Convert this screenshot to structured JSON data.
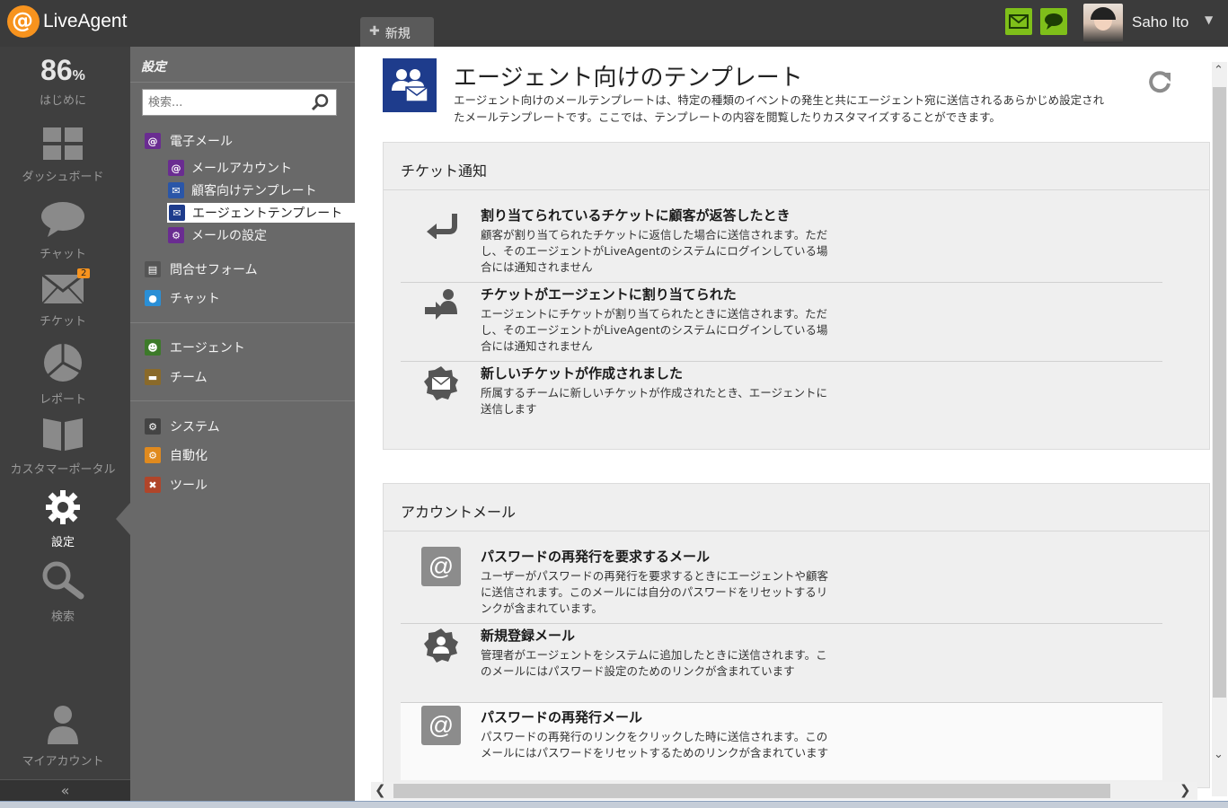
{
  "app": {
    "name": "LiveAgent",
    "new_tab": "新規"
  },
  "user": {
    "name": "Saho Ito"
  },
  "leftnav": {
    "progress_value": "86",
    "progress_unit": "%",
    "items": [
      {
        "label": "はじめに"
      },
      {
        "label": "ダッシュボード"
      },
      {
        "label": "チャット"
      },
      {
        "label": "チケット",
        "badge": "2"
      },
      {
        "label": "レポート"
      },
      {
        "label": "カスタマーポータル"
      },
      {
        "label": "設定"
      },
      {
        "label": "検索"
      },
      {
        "label": "マイアカウント"
      }
    ],
    "collapse": "«"
  },
  "settings": {
    "title": "設定",
    "search_placeholder": "検索...",
    "menu": [
      {
        "label": "電子メール"
      },
      {
        "label": "メールアカウント"
      },
      {
        "label": "顧客向けテンプレート"
      },
      {
        "label": "エージェントテンプレート"
      },
      {
        "label": "メールの設定"
      },
      {
        "label": "問合せフォーム"
      },
      {
        "label": "チャット"
      },
      {
        "label": "エージェント"
      },
      {
        "label": "チーム"
      },
      {
        "label": "システム"
      },
      {
        "label": "自動化"
      },
      {
        "label": "ツール"
      }
    ]
  },
  "page": {
    "title": "エージェント向けのテンプレート",
    "description": "エージェント向けのメールテンプレートは、特定の種類のイベントの発生と共にエージェント宛に送信されるあらかじめ設定されたメールテンプレートです。ここでは、テンプレートの内容を閲覧したりカスタマイズすることができます。"
  },
  "sections": [
    {
      "title": "チケット通知",
      "rows": [
        {
          "title": "割り当てられているチケットに顧客が返答したとき",
          "desc": "顧客が割り当てられたチケットに返信した場合に送信されます。ただし、そのエージェントがLiveAgentのシステムにログインしている場合には通知されません"
        },
        {
          "title": "チケットがエージェントに割り当てられた",
          "desc": "エージェントにチケットが割り当てられたときに送信されます。ただし、そのエージェントがLiveAgentのシステムにログインしている場合には通知されません"
        },
        {
          "title": "新しいチケットが作成されました",
          "desc": "所属するチームに新しいチケットが作成されたとき、エージェントに送信します"
        }
      ]
    },
    {
      "title": "アカウントメール",
      "rows": [
        {
          "title": "パスワードの再発行を要求するメール",
          "desc": "ユーザーがパスワードの再発行を要求するときにエージェントや顧客に送信されます。このメールには自分のパスワードをリセットするリンクが含まれています。"
        },
        {
          "title": "新規登録メール",
          "desc": "管理者がエージェントをシステムに追加したときに送信されます。このメールにはパスワード設定のためのリンクが含まれています"
        },
        {
          "title": "パスワードの再発行メール",
          "desc": "パスワードの再発行のリンクをクリックした時に送信されます。このメールにはパスワードをリセットするためのリンクが含まれています"
        }
      ]
    }
  ],
  "colors": {
    "topbar": "#3b3b3b",
    "leftnav": "#3f3f3f",
    "settings_panel": "#696969",
    "accent_green": "#7fbf1a",
    "logo_orange": "#f7931e",
    "badge_orange": "#f7931e",
    "page_icon_blue": "#1e3c8c"
  },
  "icons": {
    "topbar": [
      "mail-icon",
      "chat-icon"
    ],
    "page": "agents-mail-icon",
    "refresh": "refresh-icon"
  }
}
